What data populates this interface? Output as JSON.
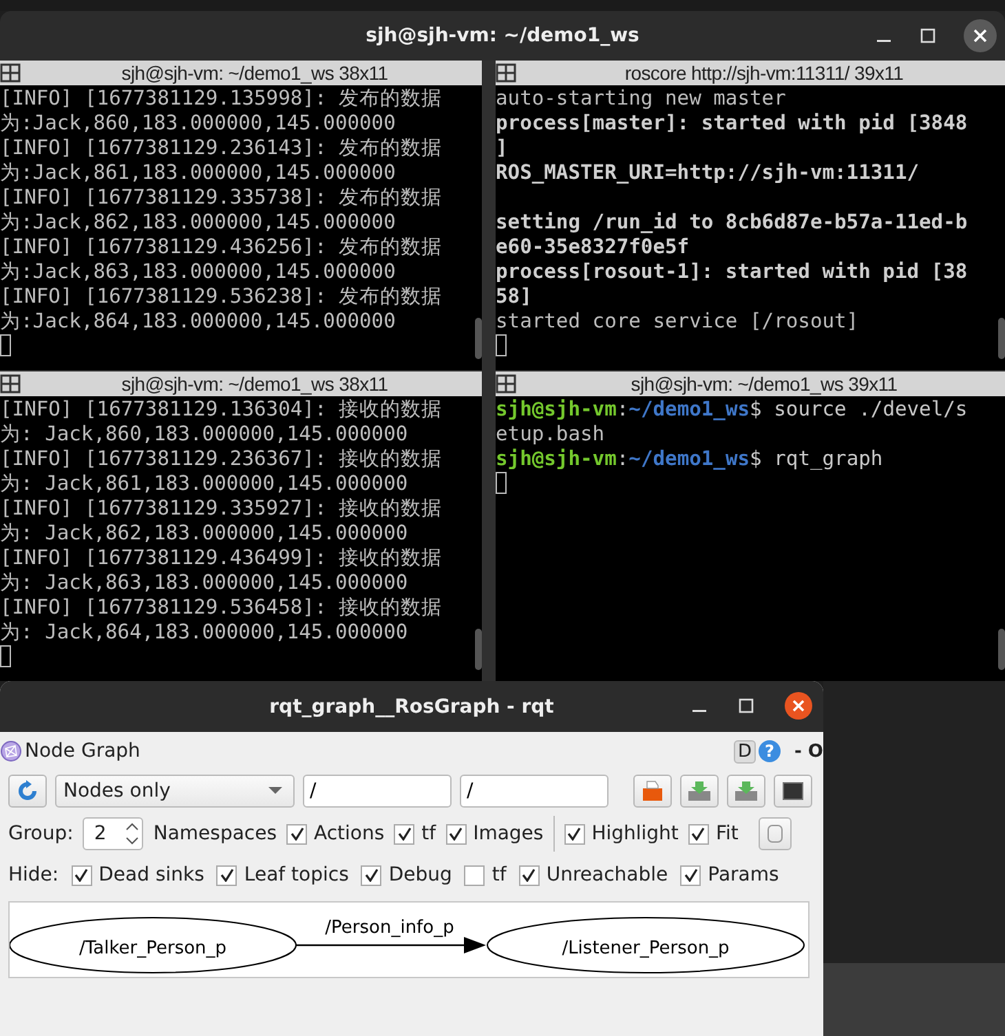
{
  "terminal": {
    "title": "sjh@sjh-vm: ~/demo1_ws",
    "panes": [
      {
        "title": "sjh@sjh-vm: ~/demo1_ws 38x11",
        "lines": [
          {
            "kind": "plain",
            "text": "[INFO] [1677381129.135998]: 发布的数据"
          },
          {
            "kind": "plain",
            "text": "为:Jack,860,183.000000,145.000000"
          },
          {
            "kind": "plain",
            "text": "[INFO] [1677381129.236143]: 发布的数据"
          },
          {
            "kind": "plain",
            "text": "为:Jack,861,183.000000,145.000000"
          },
          {
            "kind": "plain",
            "text": "[INFO] [1677381129.335738]: 发布的数据"
          },
          {
            "kind": "plain",
            "text": "为:Jack,862,183.000000,145.000000"
          },
          {
            "kind": "plain",
            "text": "[INFO] [1677381129.436256]: 发布的数据"
          },
          {
            "kind": "plain",
            "text": "为:Jack,863,183.000000,145.000000"
          },
          {
            "kind": "plain",
            "text": "[INFO] [1677381129.536238]: 发布的数据"
          },
          {
            "kind": "plain",
            "text": "为:Jack,864,183.000000,145.000000"
          }
        ]
      },
      {
        "title": "roscore http://sjh-vm:11311/ 39x11",
        "lines": [
          {
            "kind": "plain",
            "text": "auto-starting new master"
          },
          {
            "kind": "bold",
            "text": "process[master]: started with pid [3848"
          },
          {
            "kind": "bold",
            "text": "]"
          },
          {
            "kind": "bold",
            "text": "ROS_MASTER_URI=http://sjh-vm:11311/"
          },
          {
            "kind": "blank"
          },
          {
            "kind": "bold",
            "text": "setting /run_id to 8cb6d87e-b57a-11ed-b"
          },
          {
            "kind": "bold",
            "text": "e60-35e8327f0e5f"
          },
          {
            "kind": "bold",
            "text": "process[rosout-1]: started with pid [38"
          },
          {
            "kind": "bold",
            "text": "58]"
          },
          {
            "kind": "plain",
            "text": "started core service [/rosout]"
          }
        ]
      },
      {
        "title": "sjh@sjh-vm: ~/demo1_ws 38x11",
        "lines": [
          {
            "kind": "plain",
            "text": "[INFO] [1677381129.136304]: 接收的数据"
          },
          {
            "kind": "plain",
            "text": "为: Jack,860,183.000000,145.000000"
          },
          {
            "kind": "plain",
            "text": "[INFO] [1677381129.236367]: 接收的数据"
          },
          {
            "kind": "plain",
            "text": "为: Jack,861,183.000000,145.000000"
          },
          {
            "kind": "plain",
            "text": "[INFO] [1677381129.335927]: 接收的数据"
          },
          {
            "kind": "plain",
            "text": "为: Jack,862,183.000000,145.000000"
          },
          {
            "kind": "plain",
            "text": "[INFO] [1677381129.436499]: 接收的数据"
          },
          {
            "kind": "plain",
            "text": "为: Jack,863,183.000000,145.000000"
          },
          {
            "kind": "plain",
            "text": "[INFO] [1677381129.536458]: 接收的数据"
          },
          {
            "kind": "plain",
            "text": "为: Jack,864,183.000000,145.000000"
          }
        ]
      },
      {
        "title": "sjh@sjh-vm: ~/demo1_ws 39x11",
        "lines": [
          {
            "kind": "prompt",
            "user": "sjh@sjh-vm",
            "colon": ":",
            "path": "~/demo1_ws",
            "command": "$ source ./devel/s"
          },
          {
            "kind": "plain",
            "text": "etup.bash"
          },
          {
            "kind": "prompt",
            "user": "sjh@sjh-vm",
            "colon": ":",
            "path": "~/demo1_ws",
            "command": "$ rqt_graph"
          }
        ]
      }
    ]
  },
  "rqt": {
    "title": "rqt_graph__RosGraph - rqt",
    "plugin": "Node Graph",
    "plugin_buttons": [
      "D",
      "?"
    ],
    "plugin_controls": "- O",
    "mode": "Nodes only",
    "filter_1": "/",
    "filter_2": "/",
    "group_label": "Group:",
    "group_value": "2",
    "namespaces_label": "Namespaces",
    "options": [
      {
        "label": "Actions",
        "checked": true
      },
      {
        "label": "tf",
        "checked": true
      },
      {
        "label": "Images",
        "checked": true
      },
      {
        "label": "Highlight",
        "checked": true,
        "separated": true
      },
      {
        "label": "Fit",
        "checked": true
      }
    ],
    "hide_label": "Hide:",
    "hide": [
      {
        "label": "Dead sinks",
        "checked": true
      },
      {
        "label": "Leaf topics",
        "checked": true
      },
      {
        "label": "Debug",
        "checked": true
      },
      {
        "label": "tf",
        "checked": false
      },
      {
        "label": "Unreachable",
        "checked": true
      },
      {
        "label": "Params",
        "checked": true
      }
    ],
    "graph": {
      "nodes": [
        "/Talker_Person_p",
        "/Listener_Person_p"
      ],
      "edge": "/Person_info_p"
    }
  }
}
